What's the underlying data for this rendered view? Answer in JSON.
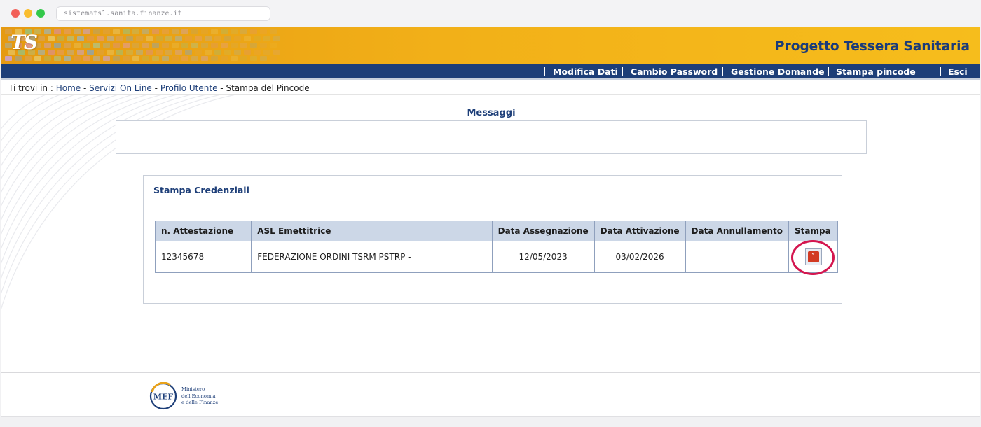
{
  "browser": {
    "url": "sistemats1.sanita.finanze.it"
  },
  "header": {
    "logo_text": "TS",
    "site_title": "Progetto Tessera Sanitaria"
  },
  "nav": {
    "items": [
      {
        "label": "Modifica Dati"
      },
      {
        "label": "Cambio Password"
      },
      {
        "label": "Gestione Domande"
      },
      {
        "label": "Stampa pincode"
      },
      {
        "label": "Esci"
      }
    ]
  },
  "breadcrumb": {
    "prefix": "Ti trovi in :",
    "links": [
      "Home",
      "Servizi On Line",
      "Profilo Utente"
    ],
    "current": "Stampa del Pincode"
  },
  "messages": {
    "title": "Messaggi",
    "content": ""
  },
  "credentials": {
    "title": "Stampa Credenziali",
    "columns": [
      "n. Attestazione",
      "ASL Emettitrice",
      "Data Assegnazione",
      "Data Attivazione",
      "Data Annullamento",
      "Stampa"
    ],
    "rows": [
      {
        "attestazione": "12345678",
        "asl": "FEDERAZIONE ORDINI TSRM PSTRP -",
        "data_assegnazione": "12/05/2023",
        "data_attivazione": "03/02/2026",
        "data_annullamento": "",
        "stampa_icon": "pdf-icon"
      }
    ]
  },
  "footer": {
    "logo_text": "MEF",
    "ministry_lines": [
      "Ministero",
      "dell'Economia",
      "e delle Finanze"
    ]
  }
}
